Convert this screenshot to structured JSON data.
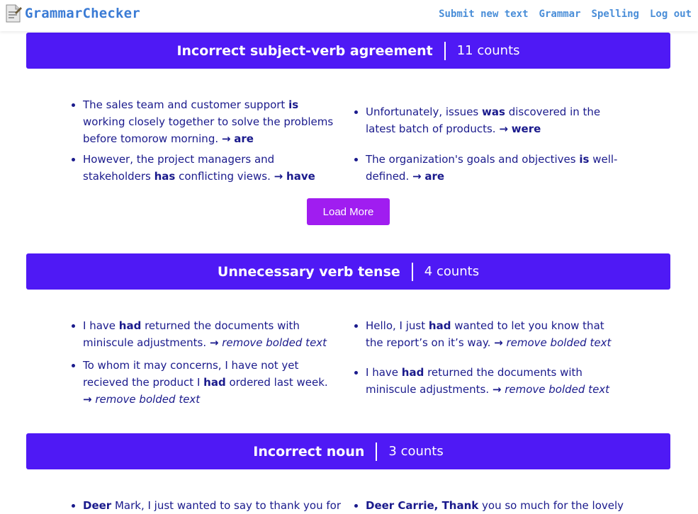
{
  "app": {
    "name": "GrammarChecker"
  },
  "nav": [
    "Submit new text",
    "Grammar",
    "Spelling",
    "Log out"
  ],
  "sections": [
    {
      "title": "Incorrect subject-verb agreement",
      "count": "11 counts",
      "items": [
        {
          "pre": "The sales team and customer support ",
          "bold": "is",
          "post": " working closely together to solve the problems before tomorow morning. ",
          "arrow": "→",
          "fix": "are"
        },
        {
          "pre": "Unfortunately, issues ",
          "bold": "was",
          "post": " discovered in the latest batch of products. ",
          "arrow": "→",
          "fix": "were"
        },
        {
          "pre": "However, the project managers and stakeholders ",
          "bold": "has",
          "post": " conflicting views. ",
          "arrow": "→",
          "fix": "have"
        },
        {
          "pre": "The organization's goals and objectives ",
          "bold": "is",
          "post": " well-defined. ",
          "arrow": "→",
          "fix": "are"
        }
      ],
      "load_more": "Load More"
    },
    {
      "title": "Unnecessary verb tense",
      "count": "4 counts",
      "items": [
        {
          "pre": "I have ",
          "bold": "had",
          "post": " returned the documents with miniscule adjustments. ",
          "arrow": "→",
          "fix": "remove bolded text"
        },
        {
          "pre": "Hello, I just ",
          "bold": "had",
          "post": " wanted to let you know that the report’s on it’s way. ",
          "arrow": "→",
          "fix": "remove bolded text"
        },
        {
          "pre": "To whom it may concerns, I have not yet recieved the product I ",
          "bold": "had",
          "post": " ordered last week. ",
          "arrow": "→",
          "fix": "remove bolded text"
        },
        {
          "pre": "I have ",
          "bold": "had",
          "post": " returned the documents with miniscule adjustments. ",
          "arrow": "→",
          "fix": "remove bolded text"
        }
      ]
    },
    {
      "title": "Incorrect noun",
      "count": "3 counts",
      "items": [
        {
          "bold": "Deer",
          "post": " Mark, I just wanted to say to thank you for"
        },
        {
          "bold": "Deer Carrie, Thank",
          "post": " you so much for the lovely"
        }
      ]
    }
  ]
}
